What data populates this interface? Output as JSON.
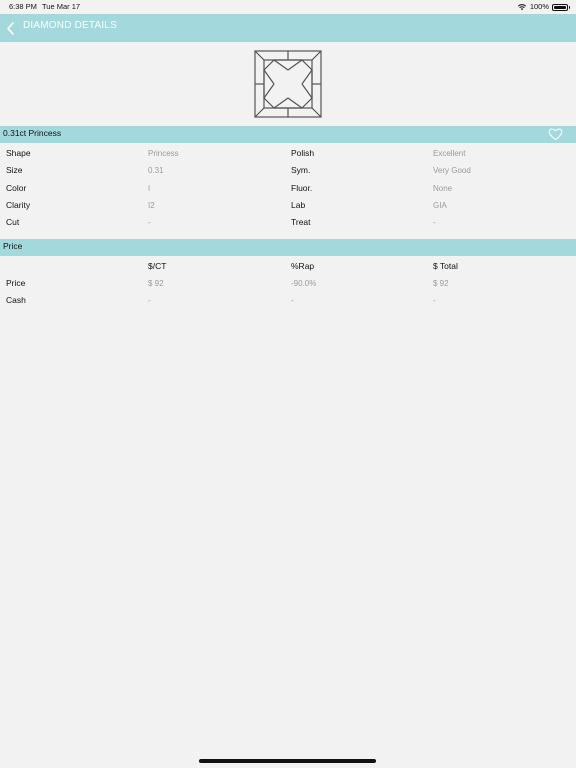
{
  "status_bar": {
    "time": "6:38 PM",
    "date": "Tue Mar 17",
    "battery": "100%",
    "battery_level": 1.0,
    "icons": [
      "wifi-icon",
      "battery-icon"
    ]
  },
  "nav": {
    "title": "DIAMOND DETAILS",
    "back_icon": "chevron-left-icon"
  },
  "diamond": {
    "image_icon": "princess-cut-diamond-icon",
    "header_title": "0.31ct Princess",
    "favorite_icon": "heart-outline-icon",
    "details": [
      {
        "label": "Shape",
        "value": "Princess",
        "label2": "Polish",
        "value2": "Excellent"
      },
      {
        "label": "Size",
        "value": "0.31",
        "label2": "Sym.",
        "value2": "Very Good"
      },
      {
        "label": "Color",
        "value": "I",
        "label2": "Fluor.",
        "value2": "None"
      },
      {
        "label": "Clarity",
        "value": "I2",
        "label2": "Lab",
        "value2": "GIA"
      },
      {
        "label": "Cut",
        "value": "-",
        "label2": "Treat",
        "value2": "-"
      }
    ]
  },
  "price": {
    "header_title": "Price",
    "columns": [
      "$/CT",
      "%Rap",
      "$ Total"
    ],
    "rows": [
      {
        "label": "Price",
        "per_ct": "$ 92",
        "rap": "-90.0%",
        "total": "$ 92"
      },
      {
        "label": "Cash",
        "per_ct": "-",
        "rap": "-",
        "total": "-"
      }
    ]
  },
  "colors": {
    "accent": "#a3d9dc",
    "background": "#f2f2f2",
    "value_text": "#9a9a9a"
  }
}
